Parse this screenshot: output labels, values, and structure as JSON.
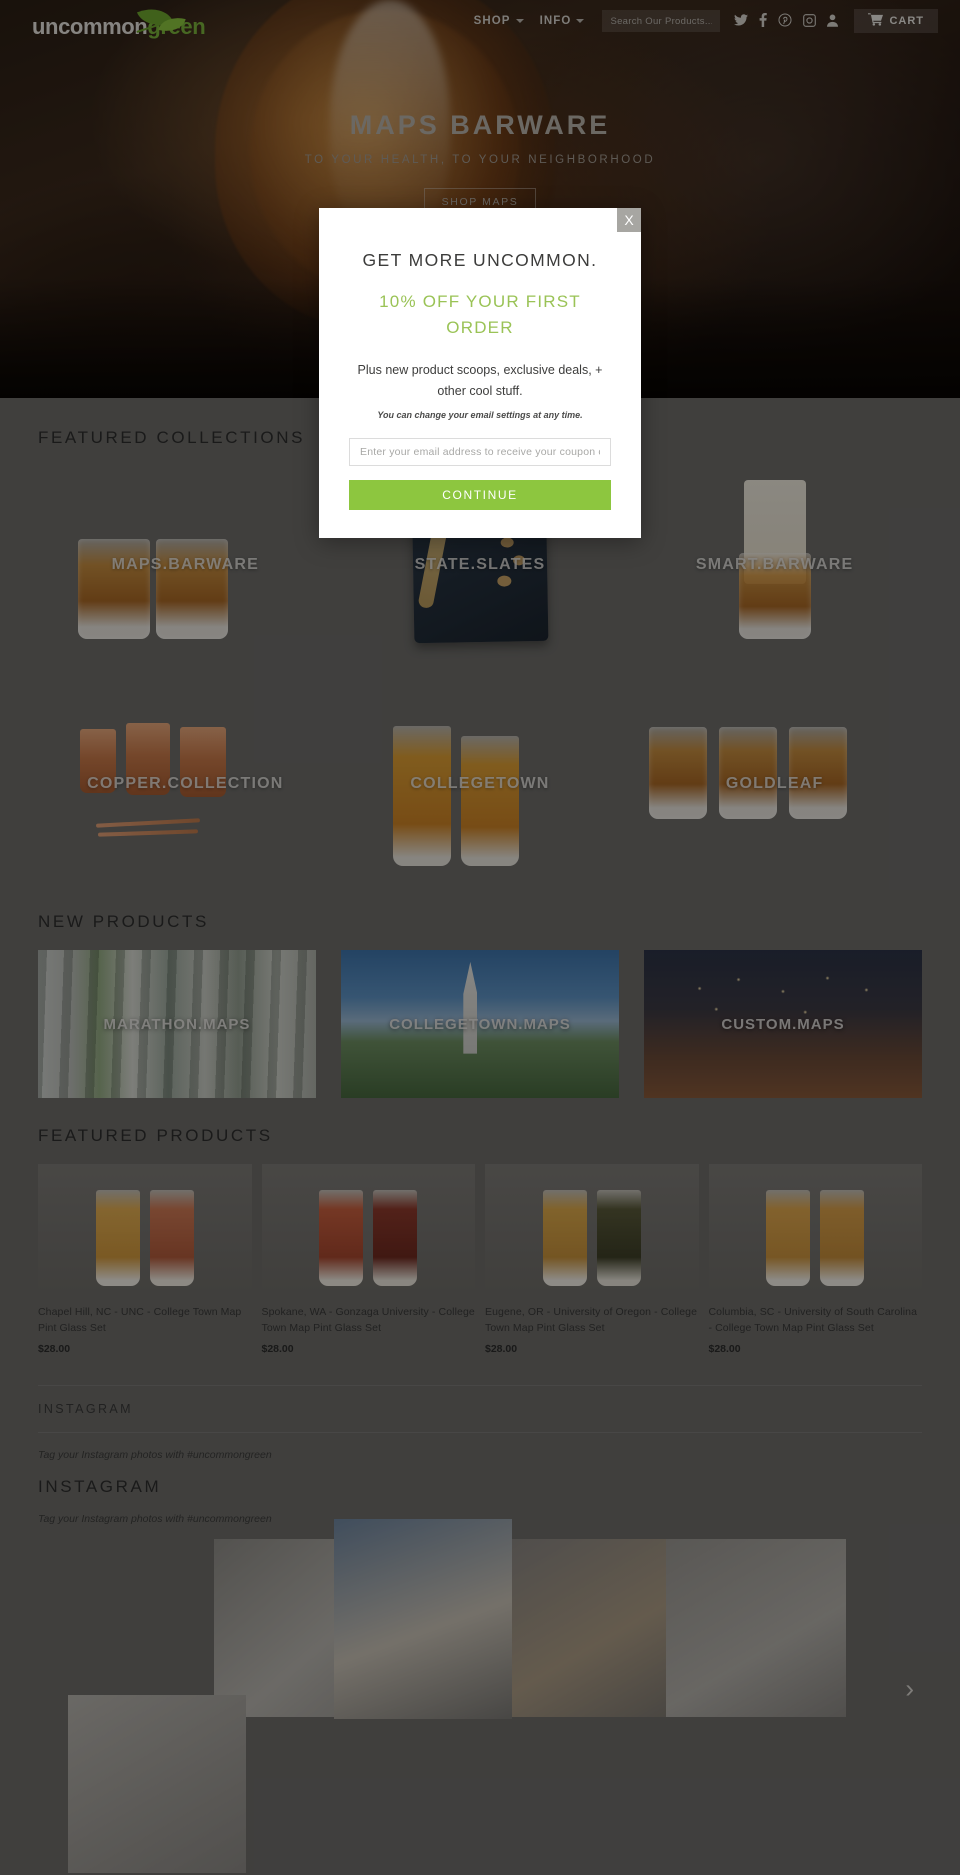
{
  "header": {
    "logo": {
      "part1": "uncommon",
      "part2": "green",
      "icon": "leaf-icon"
    },
    "nav": [
      {
        "label": "SHOP",
        "has_caret": true
      },
      {
        "label": "INFO",
        "has_caret": true
      }
    ],
    "search": {
      "placeholder": "Search Our Products...",
      "value": ""
    },
    "social": [
      {
        "name": "twitter-icon",
        "glyph": "ᵗ"
      },
      {
        "name": "facebook-icon",
        "glyph": "f"
      },
      {
        "name": "pinterest-icon",
        "glyph": "Ⓟ"
      },
      {
        "name": "instagram-icon",
        "glyph": "▣"
      },
      {
        "name": "account-icon",
        "glyph": "♟"
      }
    ],
    "cart": {
      "label": "CART",
      "icon": "cart-icon"
    }
  },
  "hero": {
    "title": "MAPS BARWARE",
    "subtitle": "TO YOUR HEALTH, TO YOUR NEIGHBORHOOD",
    "button": "SHOP MAPS"
  },
  "modal": {
    "close_label": "X",
    "heading": "GET MORE UNCOMMON.",
    "offer": "10% OFF YOUR FIRST ORDER",
    "body": "Plus new product scoops, exclusive deals, + other cool stuff.",
    "fineprint": "You can change your email settings at any time.",
    "email_placeholder": "Enter your email address to receive your coupon code.",
    "email_value": "",
    "submit_label": "CONTINUE",
    "accent_color": "#8dc63f",
    "offer_color": "#9ac356"
  },
  "featured_collections": {
    "title": "FEATURED COLLECTIONS",
    "items": [
      {
        "label": "MAPS.BARWARE",
        "art": "tumblers"
      },
      {
        "label": "STATE.SLATES",
        "art": "slate"
      },
      {
        "label": "SMART.BARWARE",
        "art": "bottle"
      },
      {
        "label": "COPPER.COLLECTION",
        "art": "copper"
      },
      {
        "label": "COLLEGETOWN",
        "art": "pints"
      },
      {
        "label": "GOLDLEAF",
        "art": "goldleaf"
      }
    ]
  },
  "new_products": {
    "title": "NEW PRODUCTS",
    "items": [
      {
        "label": "MARATHON.MAPS",
        "art": "marathon"
      },
      {
        "label": "COLLEGETOWN.MAPS",
        "art": "college"
      },
      {
        "label": "CUSTOM.MAPS",
        "art": "custom"
      }
    ]
  },
  "featured_products": {
    "title": "FEATURED PRODUCTS",
    "items": [
      {
        "title": "Chapel Hill, NC - UNC - College Town Map Pint Glass Set",
        "price": "$28.00",
        "c1": "#e3ae52",
        "c2": "#cf7a55"
      },
      {
        "title": "Spokane, WA - Gonzaga University - College Town Map Pint Glass Set",
        "price": "$28.00",
        "c1": "#c9603f",
        "c2": "#8e3a2c"
      },
      {
        "title": "Eugene, OR - University of Oregon - College Town Map Pint Glass Set",
        "price": "$28.00",
        "c1": "#ddaa4b",
        "c2": "#5a5a3a"
      },
      {
        "title": "Columbia, SC - University of South Carolina - College Town Map Pint Glass Set",
        "price": "$28.00",
        "c1": "#e0a84e",
        "c2": "#d9a04a"
      }
    ]
  },
  "instagram": {
    "title_small": "INSTAGRAM",
    "tagline_small": "Tag your Instagram photos with #uncommongreen",
    "title_large": "INSTAGRAM",
    "tagline_large": "Tag your Instagram photos with #uncommongreen",
    "next_arrow": "›"
  }
}
